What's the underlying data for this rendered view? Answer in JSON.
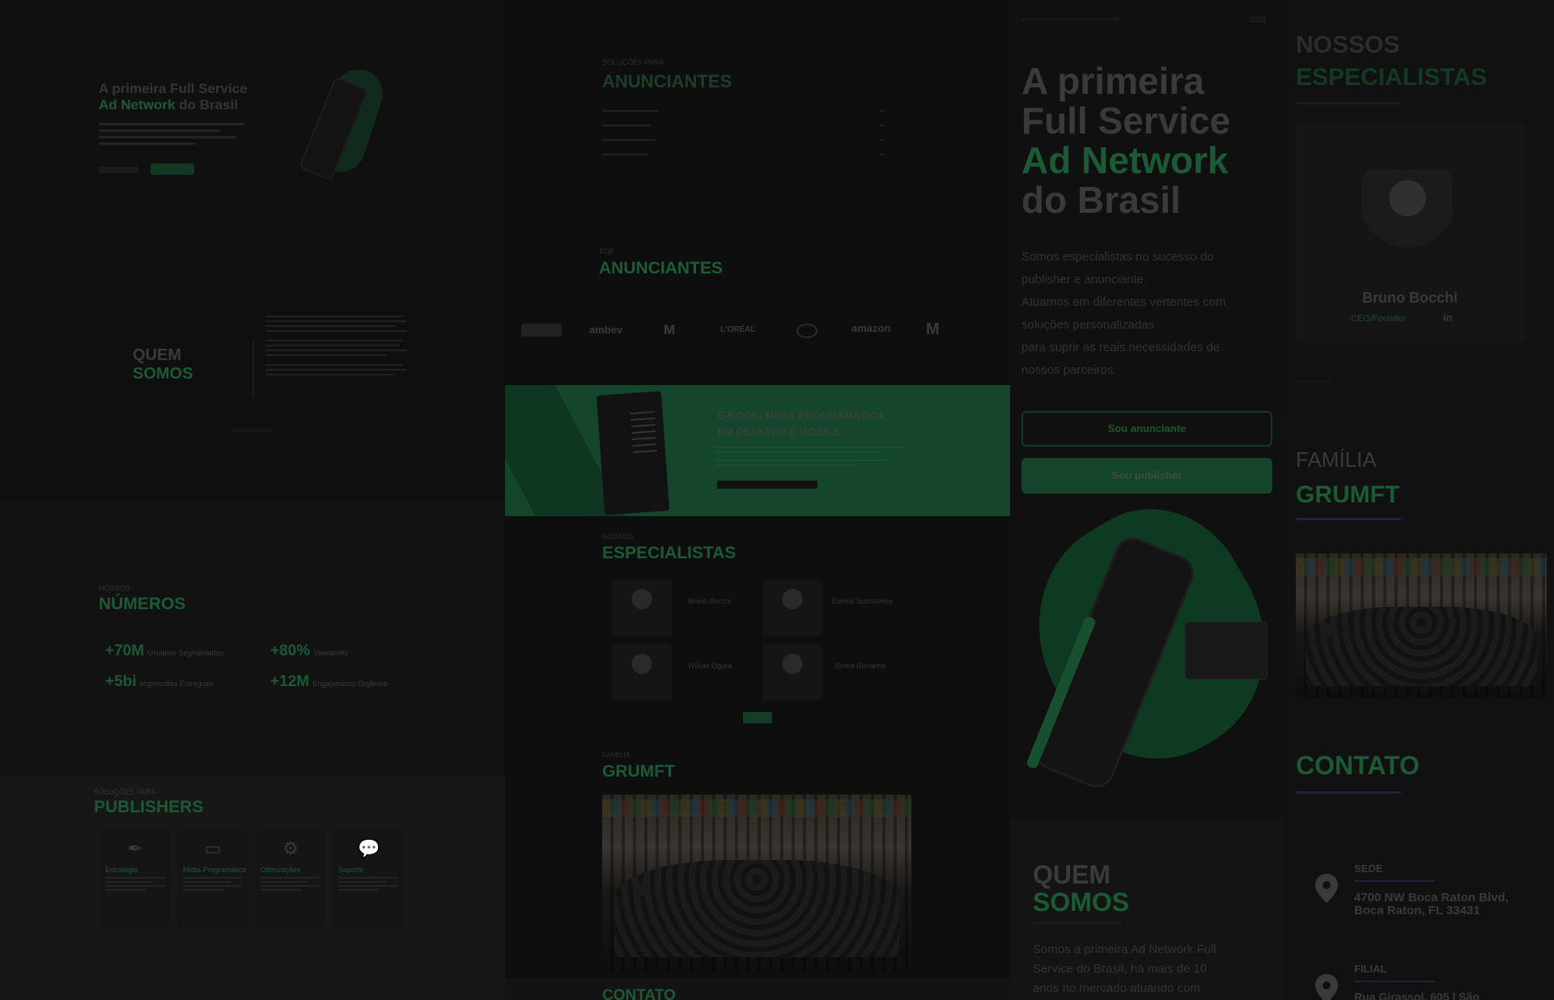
{
  "col1": {
    "hero": {
      "title_line1": "A primeira Full Service",
      "title_line2_green": "Ad Network",
      "title_line2_rest": " do Brasil"
    },
    "quem_somos": {
      "line1": "QUEM",
      "line2": "SOMOS"
    },
    "numeros": {
      "kicker": "NOSSOS",
      "title": "NÚMEROS",
      "stats": [
        {
          "value": "+70M",
          "label": "Usuários Segmentados"
        },
        {
          "value": "+80%",
          "label": "Viewability"
        },
        {
          "value": "+5bi",
          "label": "Impressões Entregues"
        },
        {
          "value": "+12M",
          "label": "Engajamento Orgânico"
        }
      ]
    },
    "publishers": {
      "kicker": "SOLUÇÕES PARA",
      "title": "PUBLISHERS",
      "cards": [
        {
          "title": "Estratégia",
          "icon": "feather-icon"
        },
        {
          "title": "Mídia Programática",
          "icon": "monitor-icon"
        },
        {
          "title": "Otimizações",
          "icon": "gears-icon"
        },
        {
          "title": "Suporte",
          "icon": "chat-icon"
        }
      ]
    }
  },
  "col2": {
    "anunciantes_top": {
      "kicker": "SOLUÇÕES PARA",
      "title": "ANUNCIANTES"
    },
    "anunciantes_logos_section": {
      "kicker": "TOP",
      "title": "ANUNCIANTES"
    },
    "logos": [
      "ambev",
      "M",
      "L'ORÉAL",
      "amazon",
      "M"
    ],
    "ebook": {
      "title_line1": "E-BOOK: MÍDIA PROGRAMÁTICA",
      "title_line2": "EM DESKTOP E MOBILE"
    },
    "especialistas": {
      "kicker": "NOSSOS",
      "title": "ESPECIALISTAS",
      "people": [
        "Bruno Bocchi",
        "Eunice Sobralense",
        "Willian Ogura",
        "Bruna Benanha"
      ]
    },
    "familia": {
      "kicker": "FAMÍLIA",
      "title": "GRUMFT"
    },
    "contato": {
      "title": "CONTATO"
    }
  },
  "col3": {
    "hero": {
      "line1": "A primeira",
      "line2": "Full Service",
      "line3_green": "Ad Network",
      "line4": "do Brasil",
      "body": [
        "Somos especialistas no sucesso do",
        "publisher e anunciante.",
        "Atuamos em diferentes vertentes com",
        "soluções personalizadas",
        "para suprir as reais necessidades de",
        "nossos parceiros."
      ],
      "btn_anunciante": "Sou anunciante",
      "btn_publisher": "Sou publisher"
    },
    "quem_somos": {
      "line1": "QUEM",
      "line2": "SOMOS",
      "body": [
        "Somos a primeira Ad Network Full",
        "Service do Brasil, há mais de 10",
        "anos no mercado atuando com"
      ]
    }
  },
  "col4": {
    "especialistas": {
      "line1": "NOSSOS",
      "line2": "ESPECIALISTAS",
      "person_name": "Bruno Bocchi",
      "person_handle": "CEO/Founder",
      "linkedin": "in"
    },
    "familia": {
      "line1": "FAMÍLIA",
      "line2": "GRUMFT"
    },
    "contato": {
      "title": "CONTATO",
      "sede_label": "SEDE",
      "sede_address_1": "4700 NW Boca Raton Blvd,",
      "sede_address_2": "Boca Raton, FL 33431",
      "filial_label": "FILIAL",
      "filial_address_1": "Rua Girassol, 605 | São"
    }
  }
}
